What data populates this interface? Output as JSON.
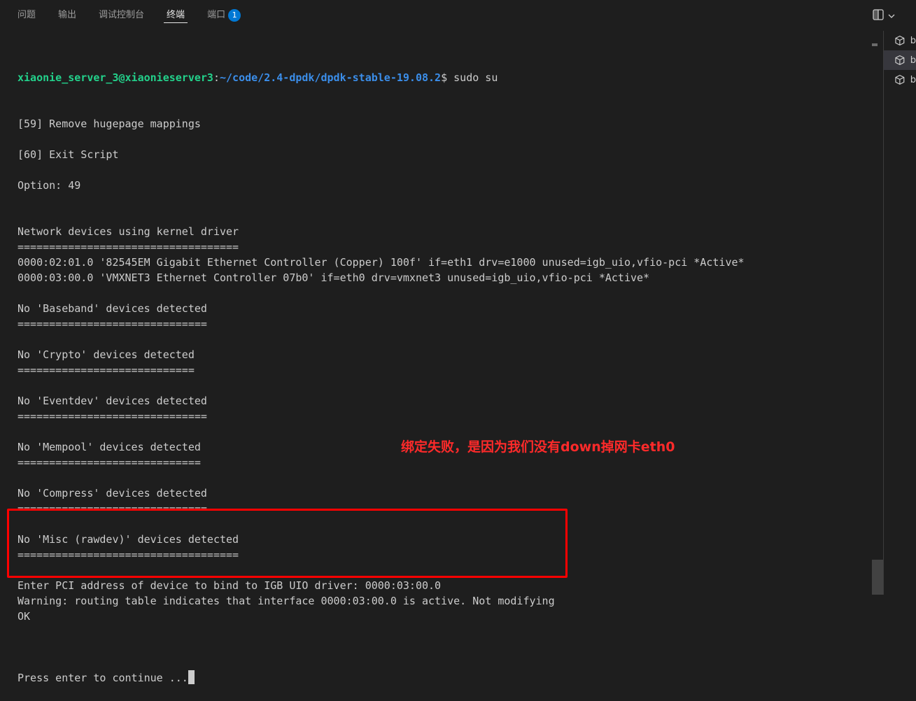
{
  "tabs": [
    {
      "label": "问题"
    },
    {
      "label": "输出"
    },
    {
      "label": "调试控制台"
    },
    {
      "label": "终端"
    },
    {
      "label": "端口",
      "badge": "1"
    }
  ],
  "active_tab": "终端",
  "terminal": {
    "prompt_user": "xiaonie_server_3@xiaonieserver3",
    "prompt_path": "~/code/2.4-dpdk/dpdk-stable-19.08.2",
    "prompt_symbol": "$",
    "prompt_command": " sudo su",
    "lines": [
      "[59] Remove hugepage mappings",
      "",
      "[60] Exit Script",
      "",
      "Option: 49",
      "",
      "",
      "Network devices using kernel driver",
      "===================================",
      "0000:02:01.0 '82545EM Gigabit Ethernet Controller (Copper) 100f' if=eth1 drv=e1000 unused=igb_uio,vfio-pci *Active*",
      "0000:03:00.0 'VMXNET3 Ethernet Controller 07b0' if=eth0 drv=vmxnet3 unused=igb_uio,vfio-pci *Active*",
      "",
      "No 'Baseband' devices detected",
      "==============================",
      "",
      "No 'Crypto' devices detected",
      "============================",
      "",
      "No 'Eventdev' devices detected",
      "==============================",
      "",
      "No 'Mempool' devices detected",
      "=============================",
      "",
      "No 'Compress' devices detected",
      "==============================",
      "",
      "No 'Misc (rawdev)' devices detected",
      "===================================",
      "",
      "Enter PCI address of device to bind to IGB UIO driver: 0000:03:00.0",
      "Warning: routing table indicates that interface 0000:03:00.0 is active. Not modifying",
      "OK",
      ""
    ],
    "last_line": "Press enter to continue ..."
  },
  "annotation": "绑定失败，是因为我们没有down掉网卡eth0",
  "side_items": [
    {
      "label": "b"
    },
    {
      "label": "b"
    },
    {
      "label": "b"
    }
  ],
  "colors": {
    "background": "#1e1e1e",
    "text": "#cccccc",
    "prompt_user": "#23d18b",
    "prompt_path": "#3b8eea",
    "annotation": "#ff2a2a",
    "badge": "#0078d4"
  }
}
